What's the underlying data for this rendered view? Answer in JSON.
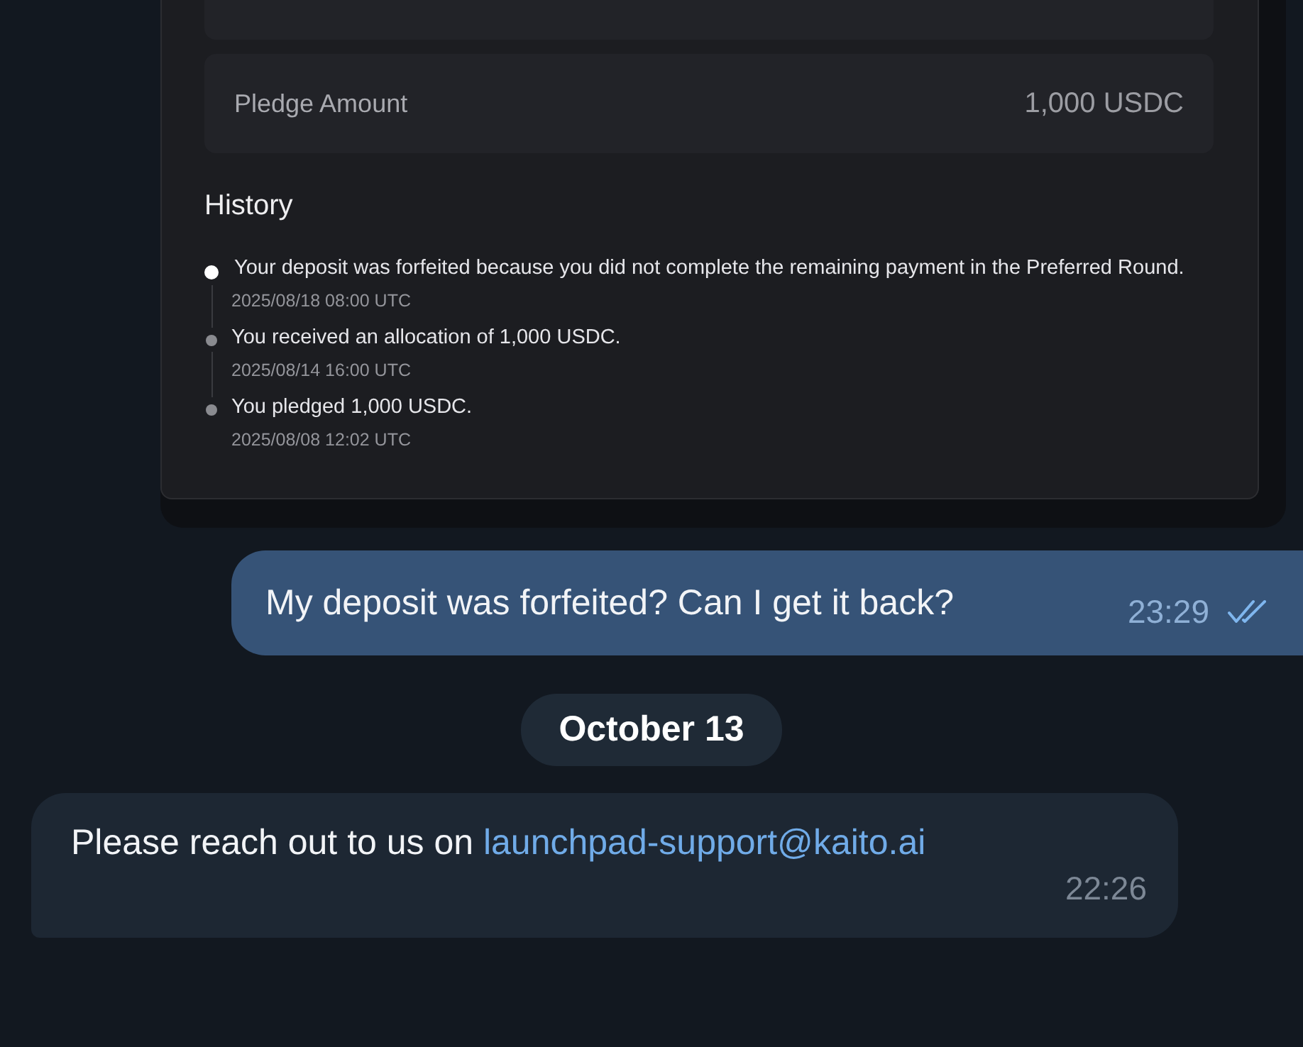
{
  "card": {
    "pledge": {
      "label": "Pledge Amount",
      "value": "1,000 USDC"
    },
    "history": {
      "title": "History",
      "events": [
        {
          "text": "Your deposit was forfeited because you did not complete the remaining payment in the Preferred Round.",
          "time": "2025/08/18 08:00 UTC",
          "current": true
        },
        {
          "text": "You received an allocation of 1,000 USDC.",
          "time": "2025/08/14 16:00 UTC",
          "current": false
        },
        {
          "text": "You pledged 1,000 USDC.",
          "time": "2025/08/08 12:02 UTC",
          "current": false
        }
      ]
    }
  },
  "messages": [
    {
      "kind": "outgoing",
      "text": "My deposit was forfeited? Can I get it back?",
      "time": "23:29",
      "read": true
    },
    {
      "kind": "date",
      "text": "October 13"
    },
    {
      "kind": "incoming",
      "text": "Please reach out to us on",
      "link": "launchpad-support@kaito.ai",
      "time": "22:26"
    }
  ]
}
